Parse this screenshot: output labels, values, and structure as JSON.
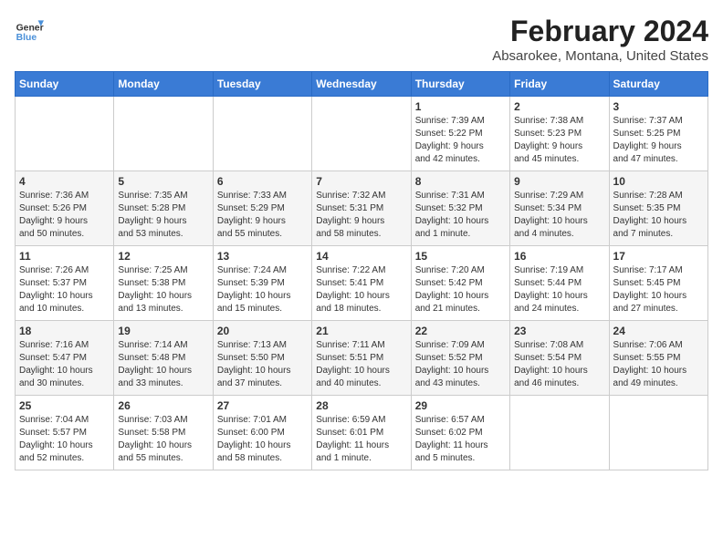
{
  "header": {
    "logo": {
      "line1": "General",
      "line2": "Blue"
    },
    "title": "February 2024",
    "subtitle": "Absarokee, Montana, United States"
  },
  "columns": [
    "Sunday",
    "Monday",
    "Tuesday",
    "Wednesday",
    "Thursday",
    "Friday",
    "Saturday"
  ],
  "weeks": [
    [
      {
        "day": "",
        "info": ""
      },
      {
        "day": "",
        "info": ""
      },
      {
        "day": "",
        "info": ""
      },
      {
        "day": "",
        "info": ""
      },
      {
        "day": "1",
        "info": "Sunrise: 7:39 AM\nSunset: 5:22 PM\nDaylight: 9 hours\nand 42 minutes."
      },
      {
        "day": "2",
        "info": "Sunrise: 7:38 AM\nSunset: 5:23 PM\nDaylight: 9 hours\nand 45 minutes."
      },
      {
        "day": "3",
        "info": "Sunrise: 7:37 AM\nSunset: 5:25 PM\nDaylight: 9 hours\nand 47 minutes."
      }
    ],
    [
      {
        "day": "4",
        "info": "Sunrise: 7:36 AM\nSunset: 5:26 PM\nDaylight: 9 hours\nand 50 minutes."
      },
      {
        "day": "5",
        "info": "Sunrise: 7:35 AM\nSunset: 5:28 PM\nDaylight: 9 hours\nand 53 minutes."
      },
      {
        "day": "6",
        "info": "Sunrise: 7:33 AM\nSunset: 5:29 PM\nDaylight: 9 hours\nand 55 minutes."
      },
      {
        "day": "7",
        "info": "Sunrise: 7:32 AM\nSunset: 5:31 PM\nDaylight: 9 hours\nand 58 minutes."
      },
      {
        "day": "8",
        "info": "Sunrise: 7:31 AM\nSunset: 5:32 PM\nDaylight: 10 hours\nand 1 minute."
      },
      {
        "day": "9",
        "info": "Sunrise: 7:29 AM\nSunset: 5:34 PM\nDaylight: 10 hours\nand 4 minutes."
      },
      {
        "day": "10",
        "info": "Sunrise: 7:28 AM\nSunset: 5:35 PM\nDaylight: 10 hours\nand 7 minutes."
      }
    ],
    [
      {
        "day": "11",
        "info": "Sunrise: 7:26 AM\nSunset: 5:37 PM\nDaylight: 10 hours\nand 10 minutes."
      },
      {
        "day": "12",
        "info": "Sunrise: 7:25 AM\nSunset: 5:38 PM\nDaylight: 10 hours\nand 13 minutes."
      },
      {
        "day": "13",
        "info": "Sunrise: 7:24 AM\nSunset: 5:39 PM\nDaylight: 10 hours\nand 15 minutes."
      },
      {
        "day": "14",
        "info": "Sunrise: 7:22 AM\nSunset: 5:41 PM\nDaylight: 10 hours\nand 18 minutes."
      },
      {
        "day": "15",
        "info": "Sunrise: 7:20 AM\nSunset: 5:42 PM\nDaylight: 10 hours\nand 21 minutes."
      },
      {
        "day": "16",
        "info": "Sunrise: 7:19 AM\nSunset: 5:44 PM\nDaylight: 10 hours\nand 24 minutes."
      },
      {
        "day": "17",
        "info": "Sunrise: 7:17 AM\nSunset: 5:45 PM\nDaylight: 10 hours\nand 27 minutes."
      }
    ],
    [
      {
        "day": "18",
        "info": "Sunrise: 7:16 AM\nSunset: 5:47 PM\nDaylight: 10 hours\nand 30 minutes."
      },
      {
        "day": "19",
        "info": "Sunrise: 7:14 AM\nSunset: 5:48 PM\nDaylight: 10 hours\nand 33 minutes."
      },
      {
        "day": "20",
        "info": "Sunrise: 7:13 AM\nSunset: 5:50 PM\nDaylight: 10 hours\nand 37 minutes."
      },
      {
        "day": "21",
        "info": "Sunrise: 7:11 AM\nSunset: 5:51 PM\nDaylight: 10 hours\nand 40 minutes."
      },
      {
        "day": "22",
        "info": "Sunrise: 7:09 AM\nSunset: 5:52 PM\nDaylight: 10 hours\nand 43 minutes."
      },
      {
        "day": "23",
        "info": "Sunrise: 7:08 AM\nSunset: 5:54 PM\nDaylight: 10 hours\nand 46 minutes."
      },
      {
        "day": "24",
        "info": "Sunrise: 7:06 AM\nSunset: 5:55 PM\nDaylight: 10 hours\nand 49 minutes."
      }
    ],
    [
      {
        "day": "25",
        "info": "Sunrise: 7:04 AM\nSunset: 5:57 PM\nDaylight: 10 hours\nand 52 minutes."
      },
      {
        "day": "26",
        "info": "Sunrise: 7:03 AM\nSunset: 5:58 PM\nDaylight: 10 hours\nand 55 minutes."
      },
      {
        "day": "27",
        "info": "Sunrise: 7:01 AM\nSunset: 6:00 PM\nDaylight: 10 hours\nand 58 minutes."
      },
      {
        "day": "28",
        "info": "Sunrise: 6:59 AM\nSunset: 6:01 PM\nDaylight: 11 hours\nand 1 minute."
      },
      {
        "day": "29",
        "info": "Sunrise: 6:57 AM\nSunset: 6:02 PM\nDaylight: 11 hours\nand 5 minutes."
      },
      {
        "day": "",
        "info": ""
      },
      {
        "day": "",
        "info": ""
      }
    ]
  ]
}
